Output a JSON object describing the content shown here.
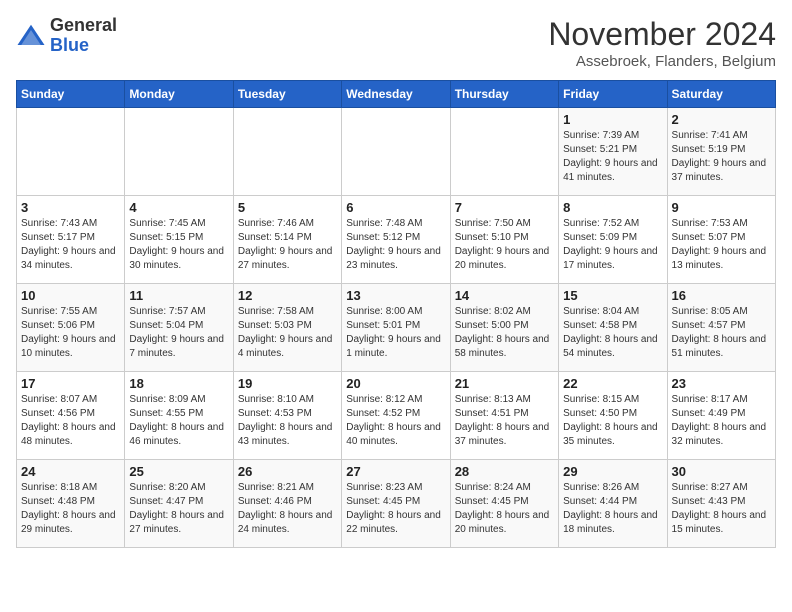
{
  "header": {
    "logo_general": "General",
    "logo_blue": "Blue",
    "month_title": "November 2024",
    "subtitle": "Assebroek, Flanders, Belgium"
  },
  "days_of_week": [
    "Sunday",
    "Monday",
    "Tuesday",
    "Wednesday",
    "Thursday",
    "Friday",
    "Saturday"
  ],
  "weeks": [
    [
      {
        "day": "",
        "info": ""
      },
      {
        "day": "",
        "info": ""
      },
      {
        "day": "",
        "info": ""
      },
      {
        "day": "",
        "info": ""
      },
      {
        "day": "",
        "info": ""
      },
      {
        "day": "1",
        "info": "Sunrise: 7:39 AM\nSunset: 5:21 PM\nDaylight: 9 hours and 41 minutes."
      },
      {
        "day": "2",
        "info": "Sunrise: 7:41 AM\nSunset: 5:19 PM\nDaylight: 9 hours and 37 minutes."
      }
    ],
    [
      {
        "day": "3",
        "info": "Sunrise: 7:43 AM\nSunset: 5:17 PM\nDaylight: 9 hours and 34 minutes."
      },
      {
        "day": "4",
        "info": "Sunrise: 7:45 AM\nSunset: 5:15 PM\nDaylight: 9 hours and 30 minutes."
      },
      {
        "day": "5",
        "info": "Sunrise: 7:46 AM\nSunset: 5:14 PM\nDaylight: 9 hours and 27 minutes."
      },
      {
        "day": "6",
        "info": "Sunrise: 7:48 AM\nSunset: 5:12 PM\nDaylight: 9 hours and 23 minutes."
      },
      {
        "day": "7",
        "info": "Sunrise: 7:50 AM\nSunset: 5:10 PM\nDaylight: 9 hours and 20 minutes."
      },
      {
        "day": "8",
        "info": "Sunrise: 7:52 AM\nSunset: 5:09 PM\nDaylight: 9 hours and 17 minutes."
      },
      {
        "day": "9",
        "info": "Sunrise: 7:53 AM\nSunset: 5:07 PM\nDaylight: 9 hours and 13 minutes."
      }
    ],
    [
      {
        "day": "10",
        "info": "Sunrise: 7:55 AM\nSunset: 5:06 PM\nDaylight: 9 hours and 10 minutes."
      },
      {
        "day": "11",
        "info": "Sunrise: 7:57 AM\nSunset: 5:04 PM\nDaylight: 9 hours and 7 minutes."
      },
      {
        "day": "12",
        "info": "Sunrise: 7:58 AM\nSunset: 5:03 PM\nDaylight: 9 hours and 4 minutes."
      },
      {
        "day": "13",
        "info": "Sunrise: 8:00 AM\nSunset: 5:01 PM\nDaylight: 9 hours and 1 minute."
      },
      {
        "day": "14",
        "info": "Sunrise: 8:02 AM\nSunset: 5:00 PM\nDaylight: 8 hours and 58 minutes."
      },
      {
        "day": "15",
        "info": "Sunrise: 8:04 AM\nSunset: 4:58 PM\nDaylight: 8 hours and 54 minutes."
      },
      {
        "day": "16",
        "info": "Sunrise: 8:05 AM\nSunset: 4:57 PM\nDaylight: 8 hours and 51 minutes."
      }
    ],
    [
      {
        "day": "17",
        "info": "Sunrise: 8:07 AM\nSunset: 4:56 PM\nDaylight: 8 hours and 48 minutes."
      },
      {
        "day": "18",
        "info": "Sunrise: 8:09 AM\nSunset: 4:55 PM\nDaylight: 8 hours and 46 minutes."
      },
      {
        "day": "19",
        "info": "Sunrise: 8:10 AM\nSunset: 4:53 PM\nDaylight: 8 hours and 43 minutes."
      },
      {
        "day": "20",
        "info": "Sunrise: 8:12 AM\nSunset: 4:52 PM\nDaylight: 8 hours and 40 minutes."
      },
      {
        "day": "21",
        "info": "Sunrise: 8:13 AM\nSunset: 4:51 PM\nDaylight: 8 hours and 37 minutes."
      },
      {
        "day": "22",
        "info": "Sunrise: 8:15 AM\nSunset: 4:50 PM\nDaylight: 8 hours and 35 minutes."
      },
      {
        "day": "23",
        "info": "Sunrise: 8:17 AM\nSunset: 4:49 PM\nDaylight: 8 hours and 32 minutes."
      }
    ],
    [
      {
        "day": "24",
        "info": "Sunrise: 8:18 AM\nSunset: 4:48 PM\nDaylight: 8 hours and 29 minutes."
      },
      {
        "day": "25",
        "info": "Sunrise: 8:20 AM\nSunset: 4:47 PM\nDaylight: 8 hours and 27 minutes."
      },
      {
        "day": "26",
        "info": "Sunrise: 8:21 AM\nSunset: 4:46 PM\nDaylight: 8 hours and 24 minutes."
      },
      {
        "day": "27",
        "info": "Sunrise: 8:23 AM\nSunset: 4:45 PM\nDaylight: 8 hours and 22 minutes."
      },
      {
        "day": "28",
        "info": "Sunrise: 8:24 AM\nSunset: 4:45 PM\nDaylight: 8 hours and 20 minutes."
      },
      {
        "day": "29",
        "info": "Sunrise: 8:26 AM\nSunset: 4:44 PM\nDaylight: 8 hours and 18 minutes."
      },
      {
        "day": "30",
        "info": "Sunrise: 8:27 AM\nSunset: 4:43 PM\nDaylight: 8 hours and 15 minutes."
      }
    ]
  ]
}
